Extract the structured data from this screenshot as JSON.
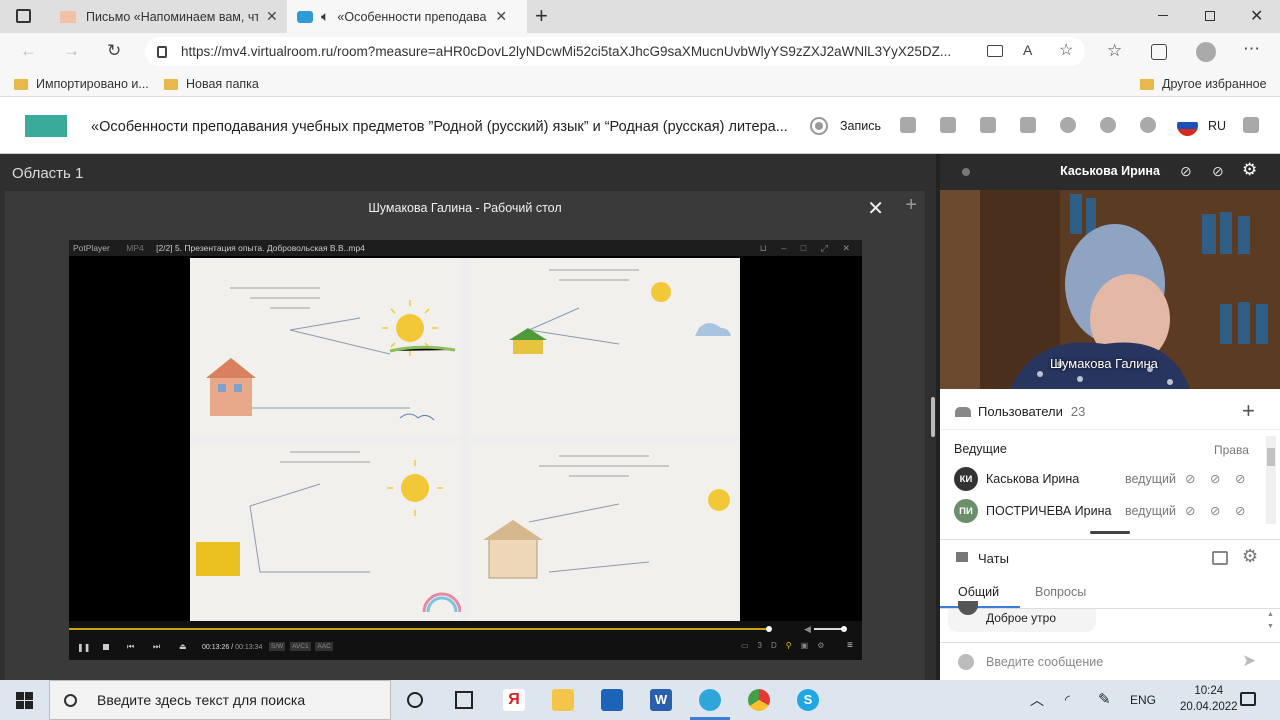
{
  "browser": {
    "tabs": [
      {
        "title": "Письмо «Напоминаем вам, что",
        "icon": "envelope-icon"
      },
      {
        "title": "«Особенности преподаван",
        "icon": "virtualroom-icon",
        "audio": "speaker-icon"
      }
    ],
    "address": "https://mv4.virtualroom.ru/room?measure=aHR0cDovL2lyNDcwMi52ci5taXJhcG9saXMucnUvbWlyYS9zZXJ2aWNlL3YyX25DZ...",
    "bookmarks": [
      "Импортировано и...",
      "Новая папка"
    ],
    "other_bookmarks": "Другое избранное"
  },
  "app": {
    "title": "«Особенности преподавания учебных предметов ”Родной (русский) язык” и “Родная (русская) литера...",
    "record_label": "Запись",
    "language": "RU"
  },
  "stage": {
    "area_label": "Область 1",
    "panel_title": "Шумакова Галина - Рабочий стол"
  },
  "player": {
    "app_name": "PotPlayer",
    "format": "MP4",
    "file": "[2/2] 5. Презентация опыта. Добровольская В.В..mp4",
    "time": "00:13:26",
    "duration": "00:13:34",
    "tags": [
      "S/W",
      "AVC1",
      "AAC"
    ],
    "progress": 0.99,
    "volume": 0.85
  },
  "camera": {
    "viewer": "Каськова Ирина",
    "caption": "Шумакова Галина"
  },
  "users": {
    "title": "Пользователи",
    "count": "23",
    "section": "Ведущие",
    "rights": "Права",
    "list": [
      {
        "initials": "КИ",
        "name": "Каськова Ирина",
        "role": "ведущий",
        "color": "#333333"
      },
      {
        "initials": "ПИ",
        "name": "ПОСТРИЧЕВА Ирина",
        "role": "ведущий",
        "color": "#6b8f6a"
      }
    ]
  },
  "chat": {
    "title": "Чаты",
    "tabs": [
      "Общий",
      "Вопросы"
    ],
    "last_message": "Доброе утро",
    "placeholder": "Введите сообщение"
  },
  "taskbar": {
    "search_placeholder": "Введите здесь текст для поиска",
    "lang": "ENG",
    "time": "10:24",
    "date": "20.04.2022"
  }
}
